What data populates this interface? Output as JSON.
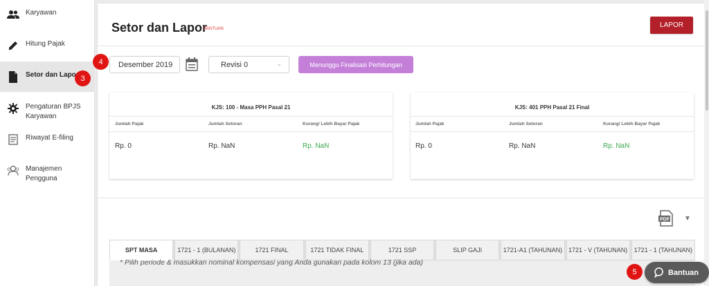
{
  "sidebar": {
    "items": [
      {
        "label": "Karyawan",
        "icon": "people-icon"
      },
      {
        "label": "Hitung Pajak",
        "icon": "pencil-icon"
      },
      {
        "label": "Setor dan Lapor",
        "icon": "document-icon",
        "active": true
      },
      {
        "label": "Pengaturan BPJS Karyawan",
        "icon": "gear-icon"
      },
      {
        "label": "Riwayat E-filing",
        "icon": "history-icon"
      },
      {
        "label": "Manajemen Pengguna",
        "icon": "users-manage-icon"
      }
    ]
  },
  "header": {
    "title": "Setor dan Lapor",
    "help_link": "BANTUAN",
    "lapor_button": "LAPOR"
  },
  "filters": {
    "period": "Desember 2019",
    "revision": "Revisi 0",
    "status_button": "Menunggu Finalisasi Perhitungan"
  },
  "kjs_cards": [
    {
      "title": "KJS: 100 - Masa PPH Pasal 21",
      "columns": [
        "Jumlah Pajak",
        "Jumlah Setoran",
        "Kurang/ Lebih Bayar Pajak"
      ],
      "values": [
        "Rp. 0",
        "Rp. NaN",
        "Rp. NaN"
      ]
    },
    {
      "title": "KJS: 401 PPH Pasal 21 Final",
      "columns": [
        "Jumlah Pajak",
        "Jumlah Setoran",
        "Kurang/ Lebih Bayar Pajak"
      ],
      "values": [
        "Rp. 0",
        "Rp. NaN",
        "Rp. NaN"
      ]
    }
  ],
  "tabs": [
    {
      "label": "SPT MASA",
      "active": true
    },
    {
      "label": "1721 - 1 (BULANAN)"
    },
    {
      "label": "1721 FINAL"
    },
    {
      "label": "1721 TIDAK FINAL"
    },
    {
      "label": "1721 SSP"
    },
    {
      "label": "SLIP GAJI"
    },
    {
      "label": "1721-A1 (TAHUNAN)"
    },
    {
      "label": "1721 - V (TAHUNAN)"
    },
    {
      "label": "1721 - 1 (TAHUNAN)"
    }
  ],
  "note": "* Pilih periode & masukkan nominal kompensasi yang Anda gunakan pada kolom 13 (jika ada)",
  "help_button": "Bantuan",
  "badges": [
    "3",
    "4",
    "5"
  ],
  "colors": {
    "primary_red": "#b3202a",
    "purple": "#c47fd9",
    "green": "#3aa64b",
    "badge_red": "#e11414"
  }
}
